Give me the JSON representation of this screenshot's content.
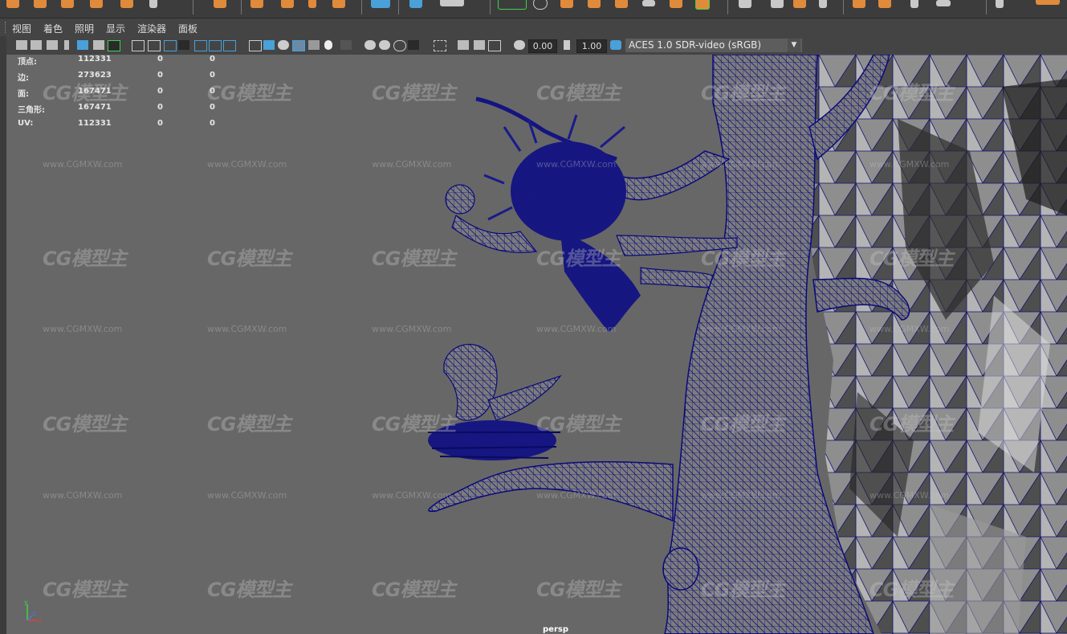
{
  "menu": [
    "视图",
    "着色",
    "照明",
    "显示",
    "渲染器",
    "面板"
  ],
  "toolbar": {
    "exposure_value": "0.00",
    "gamma_value": "1.00",
    "color_space": "ACES 1.0 SDR-video (sRGB)"
  },
  "hud": {
    "rows": [
      {
        "label": "顶点:",
        "total": "112331",
        "selected": "0",
        "components": "0"
      },
      {
        "label": "边:",
        "total": "273623",
        "selected": "0",
        "components": "0"
      },
      {
        "label": "面:",
        "total": "167471",
        "selected": "0",
        "components": "0"
      },
      {
        "label": "三角形:",
        "total": "167471",
        "selected": "0",
        "components": "0"
      },
      {
        "label": "UV:",
        "total": "112331",
        "selected": "0",
        "components": "0"
      }
    ]
  },
  "viewport": {
    "camera_label": "persp",
    "axis_x": "x",
    "axis_y": "y",
    "axis_z": "z"
  },
  "watermark": {
    "logo": "CG模型主",
    "url": "www.CGMXW.com"
  },
  "colors": {
    "viewport_bg": "#676767",
    "wireframe": "#0a0a8a",
    "shelf_icon_orange": "#e08a3c",
    "highlight_green": "#3fd34a"
  }
}
